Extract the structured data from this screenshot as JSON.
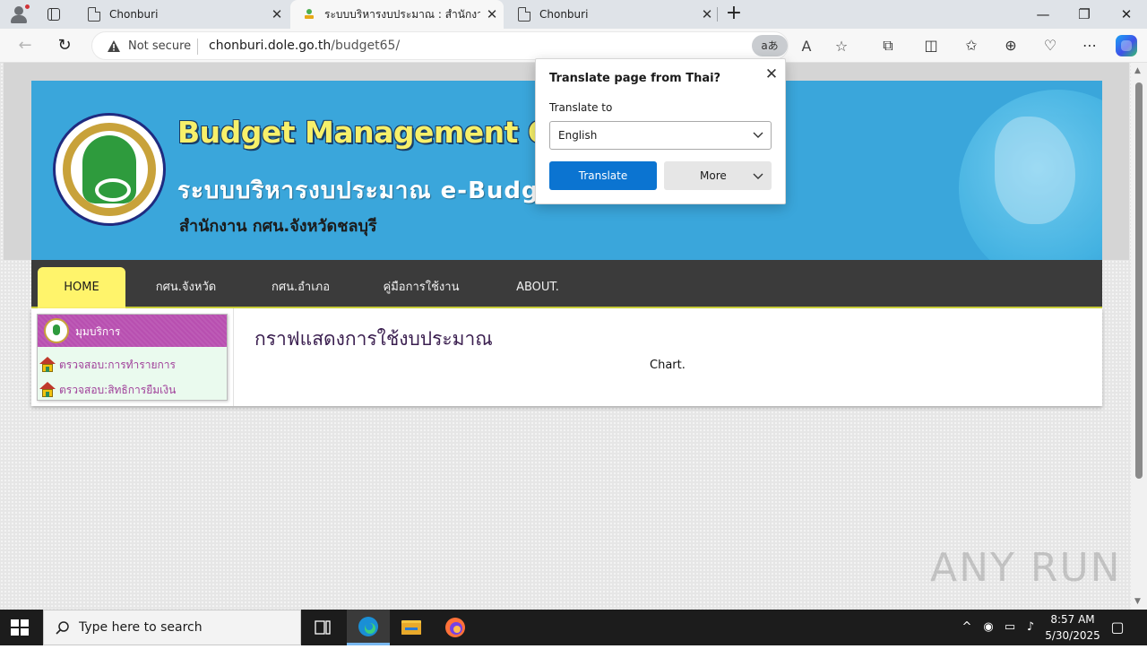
{
  "browser": {
    "tabs": [
      {
        "title": "Chonburi",
        "close": "✕"
      },
      {
        "title": "ระบบบริหารงบประมาณ : สำนักงาน กศน.",
        "close": "✕"
      },
      {
        "title": "Chonburi",
        "close": "✕"
      }
    ],
    "new_tab": "+",
    "window": {
      "minimize": "—",
      "restore": "❐",
      "close": "✕"
    },
    "security_label": "Not secure",
    "url_host": "chonburi.dole.go.th",
    "url_path": "/budget65/",
    "translate_chip": "аあ"
  },
  "site": {
    "title": "Budget Management Chonburi",
    "subtitle": "ระบบบริหารงบประมาณ e-Budget",
    "org": "สำนักงาน กศน.จังหวัดชลบุรี",
    "menu": [
      {
        "label": "HOME"
      },
      {
        "label": "กศน.จังหวัด"
      },
      {
        "label": "กศน.อำเภอ"
      },
      {
        "label": "คู่มือการใช้งาน"
      },
      {
        "label": "ABOUT."
      }
    ],
    "sidebar": {
      "title": "มุมบริการ",
      "links": [
        {
          "label": "ตรวจสอบ:การทำรายการ"
        },
        {
          "label": "ตรวจสอบ:สิทธิการยืมเงิน"
        }
      ]
    },
    "main_title": "กราฟแสดงการใช้งบประมาณ",
    "chart_placeholder": "Chart."
  },
  "translate_popup": {
    "title": "Translate page from Thai?",
    "label": "Translate to",
    "selected_language": "English",
    "translate_button": "Translate",
    "more_button": "More",
    "close": "✕"
  },
  "watermark": "ANY RUN",
  "taskbar": {
    "search_placeholder": "Type here to search",
    "time": "8:57 AM",
    "date": "5/30/2025"
  },
  "colors": {
    "banner": "#3aa6db",
    "menu_bar": "#3b3b3b",
    "menu_active": "#fff46b",
    "sidebar_head": "#b84fb0",
    "translate_button": "#0b74d1"
  }
}
